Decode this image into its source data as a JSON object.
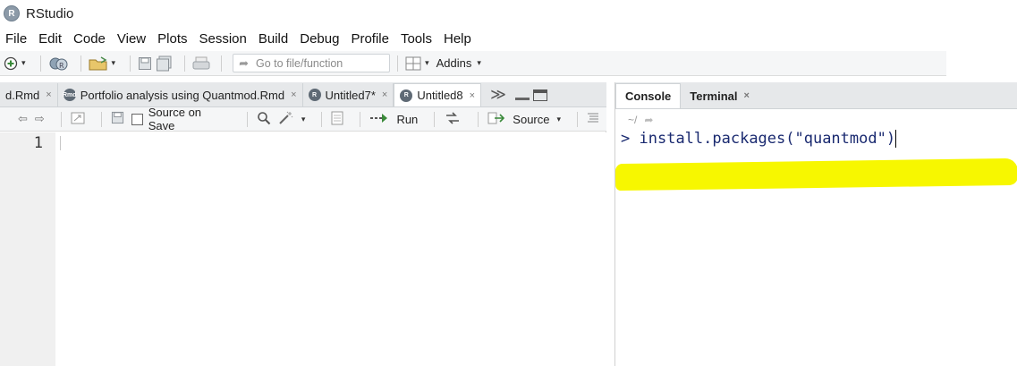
{
  "window": {
    "title": "RStudio",
    "logo_letter": "R"
  },
  "menu": [
    "File",
    "Edit",
    "Code",
    "View",
    "Plots",
    "Session",
    "Build",
    "Debug",
    "Profile",
    "Tools",
    "Help"
  ],
  "toolbar": {
    "goto_placeholder": "Go to file/function",
    "addins_label": "Addins",
    "caret": "▾",
    "icons": [
      "new-file-icon",
      "open-project-icon",
      "open-file-icon",
      "save-icon",
      "save-all-icon",
      "print-icon",
      "grid-icon"
    ]
  },
  "source_tabs": [
    {
      "label": "d.Rmd",
      "active": false,
      "icon": "none"
    },
    {
      "label": "Portfolio analysis using Quantmod.Rmd",
      "active": false,
      "icon": "rmd-icon"
    },
    {
      "label": "Untitled7*",
      "active": false,
      "icon": "r-file-icon"
    },
    {
      "label": "Untitled8",
      "active": true,
      "icon": "r-file-icon"
    }
  ],
  "tab_close_glyph": "×",
  "tab_overflow_glyph": "≫",
  "editor_toolbar": {
    "source_on_save": "Source on Save",
    "run": "Run",
    "source": "Source",
    "caret": "▾"
  },
  "editor": {
    "line_number": "1"
  },
  "console": {
    "tabs": [
      {
        "label": "Console",
        "active": true
      },
      {
        "label": "Terminal",
        "active": false
      }
    ],
    "path": "~/",
    "prompt": ">",
    "command": "install.packages(\"quantmod\")"
  },
  "colors": {
    "highlight": "#f7f700",
    "console_text": "#1a2a70"
  }
}
